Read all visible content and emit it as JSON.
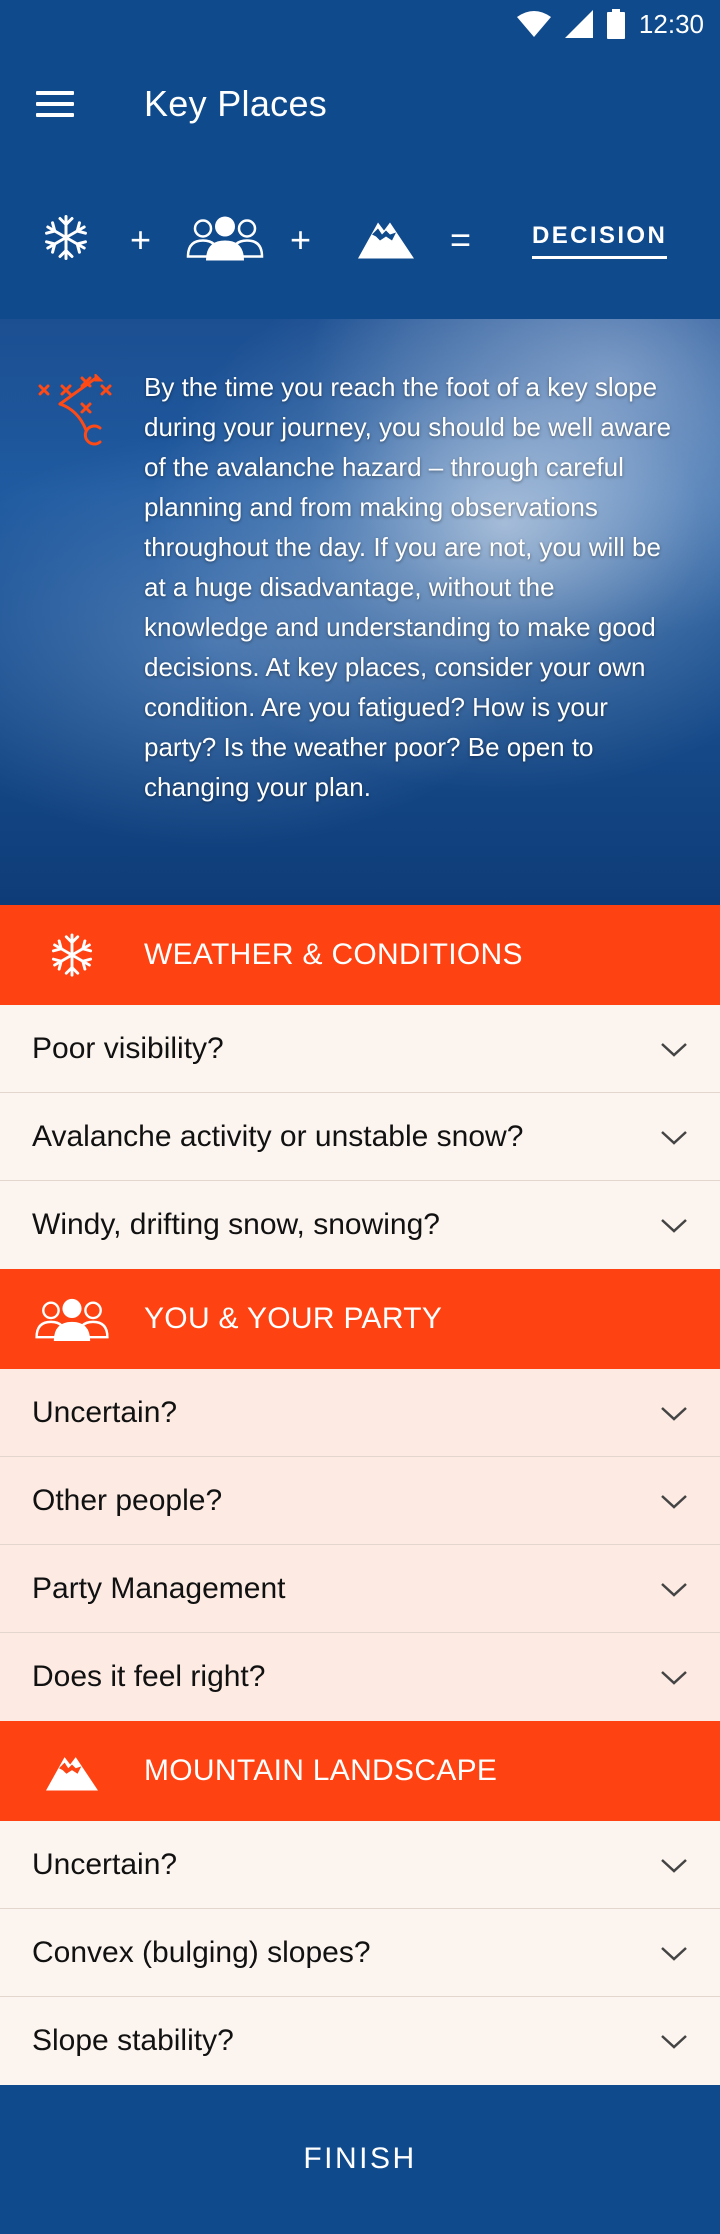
{
  "status_bar": {
    "time": "12:30"
  },
  "app_bar": {
    "title": "Key Places"
  },
  "formula": {
    "plus": "+",
    "equals": "=",
    "decision": "DECISION"
  },
  "hero": {
    "text": "By the time you reach the foot of a key slope during your journey, you should be well aware of the avalanche hazard – through careful planning and from making observations throughout the day. If you are not, you will be at a huge disadvantage, without the knowledge and understanding to make good decisions. At key places, consider your own condition. Are you fatigued? How is your party? Is the weather poor? Be open to changing your plan."
  },
  "sections": [
    {
      "title": "WEATHER & CONDITIONS",
      "icon": "snowflake-icon",
      "items": [
        "Poor visibility?",
        "Avalanche activity or unstable snow?",
        "Windy, drifting snow, snowing?"
      ]
    },
    {
      "title": "YOU & YOUR PARTY",
      "icon": "group-icon",
      "items": [
        "Uncertain?",
        "Other people?",
        "Party Management",
        "Does it feel right?"
      ]
    },
    {
      "title": "MOUNTAIN LANDSCAPE",
      "icon": "mountain-icon",
      "items": [
        "Uncertain?",
        "Convex (bulging) slopes?",
        "Slope stability?"
      ]
    }
  ],
  "finish_label": "FINISH",
  "colors": {
    "primary": "#0f4a8d",
    "accent": "#ff4212",
    "row_light": "#fcf4ef",
    "row_pink": "#fceae3"
  }
}
